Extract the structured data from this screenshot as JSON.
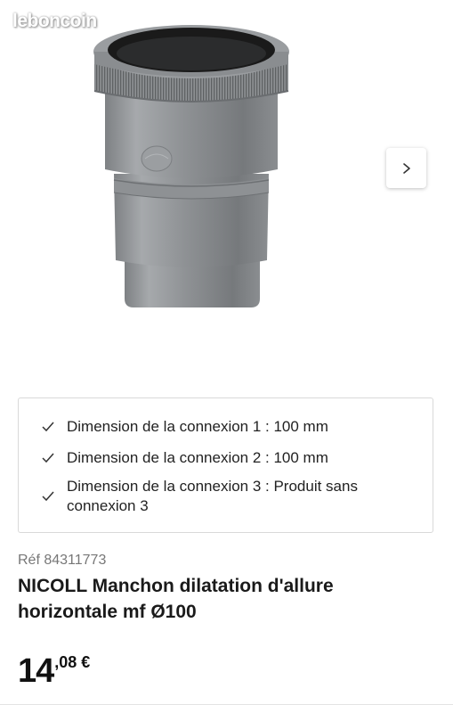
{
  "watermark": "leboncoin",
  "gallery": {
    "image_alt": "Manchon dilatation PVC gris",
    "next_icon": "chevron-right-icon"
  },
  "features": [
    {
      "icon": "check-icon",
      "text": "Dimension de la connexion 1 : 100 mm"
    },
    {
      "icon": "check-icon",
      "text": "Dimension de la connexion 2 : 100 mm"
    },
    {
      "icon": "check-icon",
      "text": "Dimension de la connexion 3 : Produit sans connexion 3"
    }
  ],
  "product": {
    "reference": "Réf 84311773",
    "title": "NICOLL Manchon dilatation d'allure horizontale mf Ø100",
    "price_integer": "14",
    "price_decimal": ",08 €"
  }
}
